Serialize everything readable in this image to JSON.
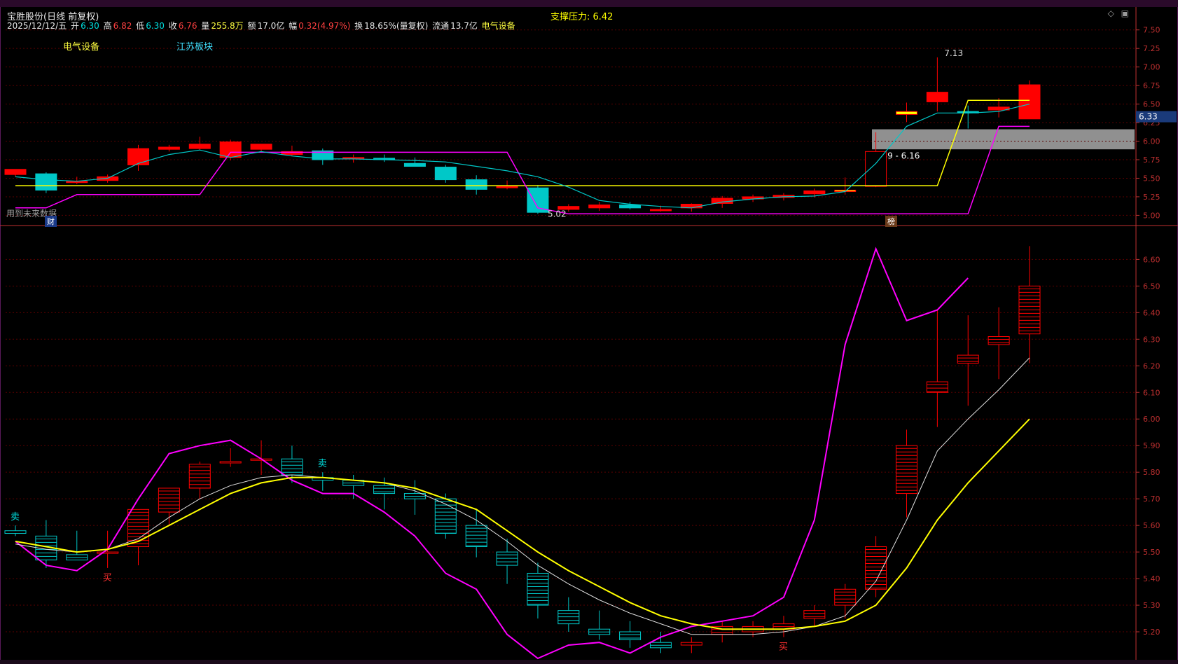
{
  "header": {
    "title": "宝胜股份(日线 前复权)",
    "date": "2025/12/12/五",
    "open_label": "开",
    "open": "6.30",
    "high_label": "高",
    "high": "6.82",
    "low_label": "低",
    "low": "6.30",
    "close_label": "收",
    "close": "6.76",
    "volume_label": "量",
    "volume": "255.8万",
    "amount_label": "额",
    "amount": "17.0亿",
    "change_label": "幅",
    "change": "0.32(4.97%)",
    "turnover_label": "换",
    "turnover": "18.65%(量复权)",
    "float_label": "流通",
    "float": "13.7亿",
    "industry": "电气设备"
  },
  "support_text": "支撑压力: 6.42",
  "sectors": {
    "first": "电气设备",
    "second": "江苏板块"
  },
  "future_data_text": "用到未来数据",
  "badge_cai": "财",
  "badge_bang": "榜",
  "corner_icons": [
    "diamond-icon",
    "window-icon"
  ],
  "colors": {
    "up": "#ff0000",
    "down": "#00c8c8",
    "ma_yellow": "#ffff00",
    "ma_magenta": "#ff00ff",
    "ma_cyan": "#00c8c8",
    "ma_white": "#e0e0e0",
    "grid": "#5a0000",
    "axis": "#c03030"
  },
  "chart_data": [
    {
      "type": "candlestick",
      "panel": "main",
      "ylim": [
        4.9,
        7.62
      ],
      "ytick_labels": [
        "7.50",
        "7.25",
        "7.00",
        "6.75",
        "6.50",
        "6.25",
        "6.00",
        "5.75",
        "5.50",
        "5.25",
        "5.00"
      ],
      "yticks": [
        7.5,
        7.25,
        7.0,
        6.75,
        6.5,
        6.25,
        6.0,
        5.75,
        5.5,
        5.25,
        5.0
      ],
      "current_price_label": "6.33",
      "current_price": 6.33,
      "zone_label": "5.89 - 6.16",
      "zone": [
        5.89,
        6.16
      ],
      "high_annotation": "7.13",
      "low_annotation": "5.02",
      "candles": [
        {
          "o": 5.55,
          "h": 5.62,
          "l": 5.52,
          "c": 5.62
        },
        {
          "o": 5.56,
          "h": 5.58,
          "l": 5.3,
          "c": 5.34
        },
        {
          "o": 5.46,
          "h": 5.52,
          "l": 5.42,
          "c": 5.46
        },
        {
          "o": 5.47,
          "h": 5.55,
          "l": 5.44,
          "c": 5.52
        },
        {
          "o": 5.68,
          "h": 5.95,
          "l": 5.6,
          "c": 5.9
        },
        {
          "o": 5.89,
          "h": 5.95,
          "l": 5.86,
          "c": 5.92
        },
        {
          "o": 5.9,
          "h": 6.06,
          "l": 5.88,
          "c": 5.96
        },
        {
          "o": 5.78,
          "h": 6.02,
          "l": 5.74,
          "c": 5.99
        },
        {
          "o": 5.89,
          "h": 5.96,
          "l": 5.86,
          "c": 5.96
        },
        {
          "o": 5.82,
          "h": 5.94,
          "l": 5.8,
          "c": 5.86
        },
        {
          "o": 5.87,
          "h": 5.9,
          "l": 5.68,
          "c": 5.75
        },
        {
          "o": 5.76,
          "h": 5.82,
          "l": 5.71,
          "c": 5.78
        },
        {
          "o": 5.77,
          "h": 5.82,
          "l": 5.72,
          "c": 5.76
        },
        {
          "o": 5.7,
          "h": 5.78,
          "l": 5.66,
          "c": 5.66
        },
        {
          "o": 5.65,
          "h": 5.68,
          "l": 5.44,
          "c": 5.48
        },
        {
          "o": 5.48,
          "h": 5.54,
          "l": 5.28,
          "c": 5.35
        },
        {
          "o": 5.39,
          "h": 5.47,
          "l": 5.35,
          "c": 5.39
        },
        {
          "o": 5.37,
          "h": 5.41,
          "l": 5.02,
          "c": 5.04
        },
        {
          "o": 5.08,
          "h": 5.15,
          "l": 5.05,
          "c": 5.12
        },
        {
          "o": 5.1,
          "h": 5.18,
          "l": 5.06,
          "c": 5.14
        },
        {
          "o": 5.14,
          "h": 5.18,
          "l": 5.08,
          "c": 5.1
        },
        {
          "o": 5.08,
          "h": 5.13,
          "l": 5.05,
          "c": 5.08
        },
        {
          "o": 5.1,
          "h": 5.16,
          "l": 5.05,
          "c": 5.15
        },
        {
          "o": 5.16,
          "h": 5.26,
          "l": 5.1,
          "c": 5.23
        },
        {
          "o": 5.22,
          "h": 5.28,
          "l": 5.18,
          "c": 5.25
        },
        {
          "o": 5.24,
          "h": 5.3,
          "l": 5.2,
          "c": 5.27
        },
        {
          "o": 5.29,
          "h": 5.36,
          "l": 5.24,
          "c": 5.33
        },
        {
          "o": 5.32,
          "h": 5.51,
          "l": 5.28,
          "c": 5.34
        },
        {
          "o": 5.39,
          "h": 6.12,
          "l": 5.38,
          "c": 5.86
        },
        {
          "o": 6.36,
          "h": 6.52,
          "l": 6.26,
          "c": 6.4
        },
        {
          "o": 6.53,
          "h": 7.13,
          "l": 6.4,
          "c": 6.66
        },
        {
          "o": 6.4,
          "h": 6.48,
          "l": 6.17,
          "c": 6.38
        },
        {
          "o": 6.42,
          "h": 6.58,
          "l": 6.32,
          "c": 6.46
        },
        {
          "o": 6.3,
          "h": 6.82,
          "l": 6.3,
          "c": 6.76
        }
      ],
      "ma_cyan": [
        5.52,
        5.48,
        5.46,
        5.5,
        5.7,
        5.82,
        5.88,
        5.78,
        5.86,
        5.8,
        5.76,
        5.76,
        5.75,
        5.74,
        5.72,
        5.66,
        5.6,
        5.52,
        5.38,
        5.2,
        5.15,
        5.12,
        5.1,
        5.18,
        5.22,
        5.25,
        5.26,
        5.32,
        5.7,
        6.2,
        6.38,
        6.38,
        6.4,
        6.5
      ],
      "ma_yellow": [
        5.4,
        5.4,
        5.4,
        5.4,
        5.4,
        5.4,
        5.4,
        5.4,
        5.4,
        5.4,
        5.4,
        5.4,
        5.4,
        5.4,
        5.4,
        5.4,
        5.4,
        5.4,
        5.4,
        5.4,
        5.4,
        5.4,
        5.4,
        5.4,
        5.4,
        5.4,
        5.4,
        5.4,
        5.4,
        5.4,
        5.4,
        6.55,
        6.55,
        6.55
      ],
      "ma_magenta": [
        5.1,
        5.1,
        5.28,
        5.28,
        5.28,
        5.28,
        5.28,
        5.85,
        5.85,
        5.85,
        5.85,
        5.85,
        5.85,
        5.85,
        5.85,
        5.85,
        5.85,
        5.1,
        5.02,
        5.02,
        5.02,
        5.02,
        5.02,
        5.02,
        5.02,
        5.02,
        5.02,
        5.02,
        5.02,
        5.02,
        5.02,
        5.02,
        6.2,
        6.2
      ],
      "bar_labels": [
        "宝胜股份"
      ]
    },
    {
      "type": "candlestick",
      "panel": "lower",
      "ylim": [
        5.1,
        6.68
      ],
      "ytick_labels": [
        "6.60",
        "6.50",
        "6.40",
        "6.30",
        "6.20",
        "6.10",
        "6.00",
        "5.90",
        "5.80",
        "5.70",
        "5.60",
        "5.50",
        "5.40",
        "5.30",
        "5.20"
      ],
      "yticks": [
        6.6,
        6.5,
        6.4,
        6.3,
        6.2,
        6.1,
        6.0,
        5.9,
        5.8,
        5.7,
        5.6,
        5.5,
        5.4,
        5.3,
        5.2
      ],
      "signals": [
        {
          "index": 0,
          "text": "卖",
          "side": "top"
        },
        {
          "index": 3,
          "text": "买",
          "side": "bottom"
        },
        {
          "index": 10,
          "text": "卖",
          "side": "top"
        },
        {
          "index": 25,
          "text": "买",
          "side": "bottom"
        }
      ],
      "candles": [
        {
          "o": 5.58,
          "h": 5.6,
          "l": 5.56,
          "c": 5.57
        },
        {
          "o": 5.56,
          "h": 5.62,
          "l": 5.44,
          "c": 5.47
        },
        {
          "o": 5.49,
          "h": 5.58,
          "l": 5.47,
          "c": 5.47
        },
        {
          "o": 5.5,
          "h": 5.58,
          "l": 5.44,
          "c": 5.5
        },
        {
          "o": 5.52,
          "h": 5.64,
          "l": 5.45,
          "c": 5.66
        },
        {
          "o": 5.65,
          "h": 5.73,
          "l": 5.6,
          "c": 5.74
        },
        {
          "o": 5.74,
          "h": 5.84,
          "l": 5.7,
          "c": 5.83
        },
        {
          "o": 5.84,
          "h": 5.89,
          "l": 5.82,
          "c": 5.84
        },
        {
          "o": 5.85,
          "h": 5.92,
          "l": 5.79,
          "c": 5.85
        },
        {
          "o": 5.85,
          "h": 5.9,
          "l": 5.76,
          "c": 5.79
        },
        {
          "o": 5.78,
          "h": 5.8,
          "l": 5.73,
          "c": 5.77
        },
        {
          "o": 5.77,
          "h": 5.79,
          "l": 5.7,
          "c": 5.75
        },
        {
          "o": 5.75,
          "h": 5.78,
          "l": 5.66,
          "c": 5.72
        },
        {
          "o": 5.72,
          "h": 5.77,
          "l": 5.64,
          "c": 5.7
        },
        {
          "o": 5.7,
          "h": 5.72,
          "l": 5.55,
          "c": 5.57
        },
        {
          "o": 5.6,
          "h": 5.66,
          "l": 5.48,
          "c": 5.52
        },
        {
          "o": 5.5,
          "h": 5.55,
          "l": 5.38,
          "c": 5.45
        },
        {
          "o": 5.42,
          "h": 5.46,
          "l": 5.25,
          "c": 5.3
        },
        {
          "o": 5.28,
          "h": 5.33,
          "l": 5.2,
          "c": 5.23
        },
        {
          "o": 5.21,
          "h": 5.28,
          "l": 5.17,
          "c": 5.19
        },
        {
          "o": 5.2,
          "h": 5.24,
          "l": 5.14,
          "c": 5.17
        },
        {
          "o": 5.16,
          "h": 5.2,
          "l": 5.12,
          "c": 5.14
        },
        {
          "o": 5.15,
          "h": 5.18,
          "l": 5.12,
          "c": 5.16
        },
        {
          "o": 5.19,
          "h": 5.24,
          "l": 5.16,
          "c": 5.22
        },
        {
          "o": 5.2,
          "h": 5.24,
          "l": 5.18,
          "c": 5.22
        },
        {
          "o": 5.21,
          "h": 5.26,
          "l": 5.18,
          "c": 5.23
        },
        {
          "o": 5.25,
          "h": 5.3,
          "l": 5.22,
          "c": 5.28
        },
        {
          "o": 5.3,
          "h": 5.38,
          "l": 5.25,
          "c": 5.36
        },
        {
          "o": 5.36,
          "h": 5.56,
          "l": 5.33,
          "c": 5.52
        },
        {
          "o": 5.72,
          "h": 5.96,
          "l": 5.63,
          "c": 5.9
        },
        {
          "o": 6.1,
          "h": 6.41,
          "l": 5.97,
          "c": 6.14
        },
        {
          "o": 6.21,
          "h": 6.39,
          "l": 6.05,
          "c": 6.24
        },
        {
          "o": 6.28,
          "h": 6.42,
          "l": 6.15,
          "c": 6.31
        },
        {
          "o": 6.32,
          "h": 6.65,
          "l": 6.21,
          "c": 6.5
        }
      ],
      "ma_white": [
        5.53,
        5.51,
        5.5,
        5.51,
        5.55,
        5.63,
        5.7,
        5.75,
        5.78,
        5.79,
        5.78,
        5.77,
        5.76,
        5.73,
        5.68,
        5.62,
        5.54,
        5.45,
        5.38,
        5.32,
        5.27,
        5.23,
        5.19,
        5.19,
        5.19,
        5.2,
        5.22,
        5.26,
        5.39,
        5.62,
        5.88,
        6.0,
        6.11,
        6.23
      ],
      "ma_yellow": [
        5.54,
        5.52,
        5.5,
        5.51,
        5.54,
        5.6,
        5.66,
        5.72,
        5.76,
        5.78,
        5.78,
        5.77,
        5.76,
        5.74,
        5.7,
        5.66,
        5.58,
        5.5,
        5.43,
        5.37,
        5.31,
        5.26,
        5.23,
        5.21,
        5.21,
        5.21,
        5.22,
        5.24,
        5.3,
        5.44,
        5.62,
        5.76,
        5.88,
        6.0
      ],
      "ma_magenta": [
        5.54,
        5.45,
        5.43,
        5.51,
        5.7,
        5.87,
        5.9,
        5.92,
        5.85,
        5.77,
        5.72,
        5.72,
        5.65,
        5.56,
        5.42,
        5.36,
        5.19,
        5.1,
        5.15,
        5.16,
        5.12,
        5.18,
        5.22,
        5.24,
        5.26,
        5.33,
        5.62,
        6.28,
        6.64,
        6.37,
        6.41,
        6.53
      ]
    }
  ]
}
